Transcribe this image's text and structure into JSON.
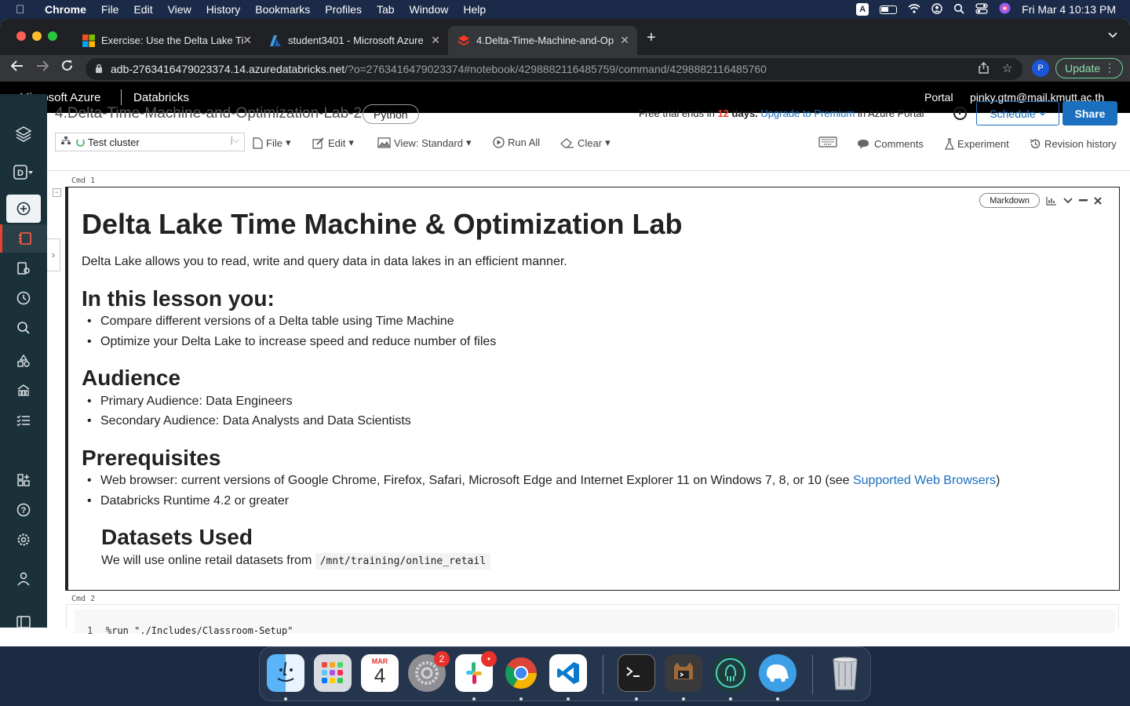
{
  "menubar": {
    "app": "Chrome",
    "items": [
      "File",
      "Edit",
      "View",
      "History",
      "Bookmarks",
      "Profiles",
      "Tab",
      "Window",
      "Help"
    ],
    "input_indicator": "A",
    "datetime": "Fri Mar 4  10:13 PM"
  },
  "browser": {
    "tabs": [
      {
        "title": "Exercise: Use the Delta Lake Ti"
      },
      {
        "title": "student3401 - Microsoft Azure"
      },
      {
        "title": "4.Delta-Time-Machine-and-Op"
      }
    ],
    "url_host": "adb-2763416479023374.14.azuredatabricks.net",
    "url_path": "/?o=2763416479023374#notebook/4298882116485759/command/4298882116485760",
    "profile_initial": "P",
    "update_label": "Update"
  },
  "azure_header": {
    "brand": "Microsoft Azure",
    "product": "Databricks",
    "portal": "Portal",
    "user": "pinky.gtm@mail.kmutt.ac.th"
  },
  "notebook": {
    "title": "4.Delta-Time-Machine-and-Optimization-Lab-2",
    "language": "Python",
    "trial_prefix": "Free trial ends in",
    "trial_days": "12",
    "trial_mid": "days.",
    "trial_link": "Upgrade to Premium",
    "trial_suffix": "in Azure Portal",
    "schedule_label": "Schedule",
    "share_label": "Share",
    "toolbar": {
      "cluster": "Test cluster",
      "file": "File",
      "edit": "Edit",
      "view": "View: Standard",
      "run_all": "Run All",
      "clear": "Clear",
      "comments": "Comments",
      "experiment": "Experiment",
      "revision_history": "Revision history"
    }
  },
  "cells": {
    "cmd1_label": "Cmd  1",
    "cmd2_label": "Cmd  2",
    "cell_type": "Markdown",
    "markdown": {
      "h1": "Delta Lake Time Machine & Optimization Lab",
      "intro": "Delta Lake allows you to read, write and query data in data lakes in an efficient manner.",
      "lesson_heading": "In this lesson you:",
      "lesson_items": [
        "Compare different versions of a Delta table using Time Machine",
        "Optimize your Delta Lake to increase speed and reduce number of files"
      ],
      "audience_heading": "Audience",
      "audience_items": [
        "Primary Audience: Data Engineers",
        "Secondary Audience: Data Analysts and Data Scientists"
      ],
      "prereq_heading": "Prerequisites",
      "prereq_item1_text": "Web browser: current versions of Google Chrome, Firefox, Safari, Microsoft Edge and Internet Explorer 11 on Windows 7, 8, or 10 (see",
      "prereq_item1_link": "Supported Web Browsers",
      "prereq_item1_end": ")",
      "prereq_item2": "Databricks Runtime 4.2 or greater",
      "datasets_heading": "Datasets Used",
      "datasets_text": "We will use online retail datasets from",
      "datasets_path": "/mnt/training/online_retail"
    },
    "cmd2_line_number": "1",
    "cmd2_code": "%run \"./Includes/Classroom-Setup\""
  },
  "dock": {
    "calendar_month": "MAR",
    "calendar_day": "4",
    "settings_badge": "2",
    "slack_badge": "•"
  },
  "colors": {
    "accent_blue": "#1a6fbf",
    "sidebar_bg": "#1b3139",
    "trial_red": "#e8432d"
  }
}
